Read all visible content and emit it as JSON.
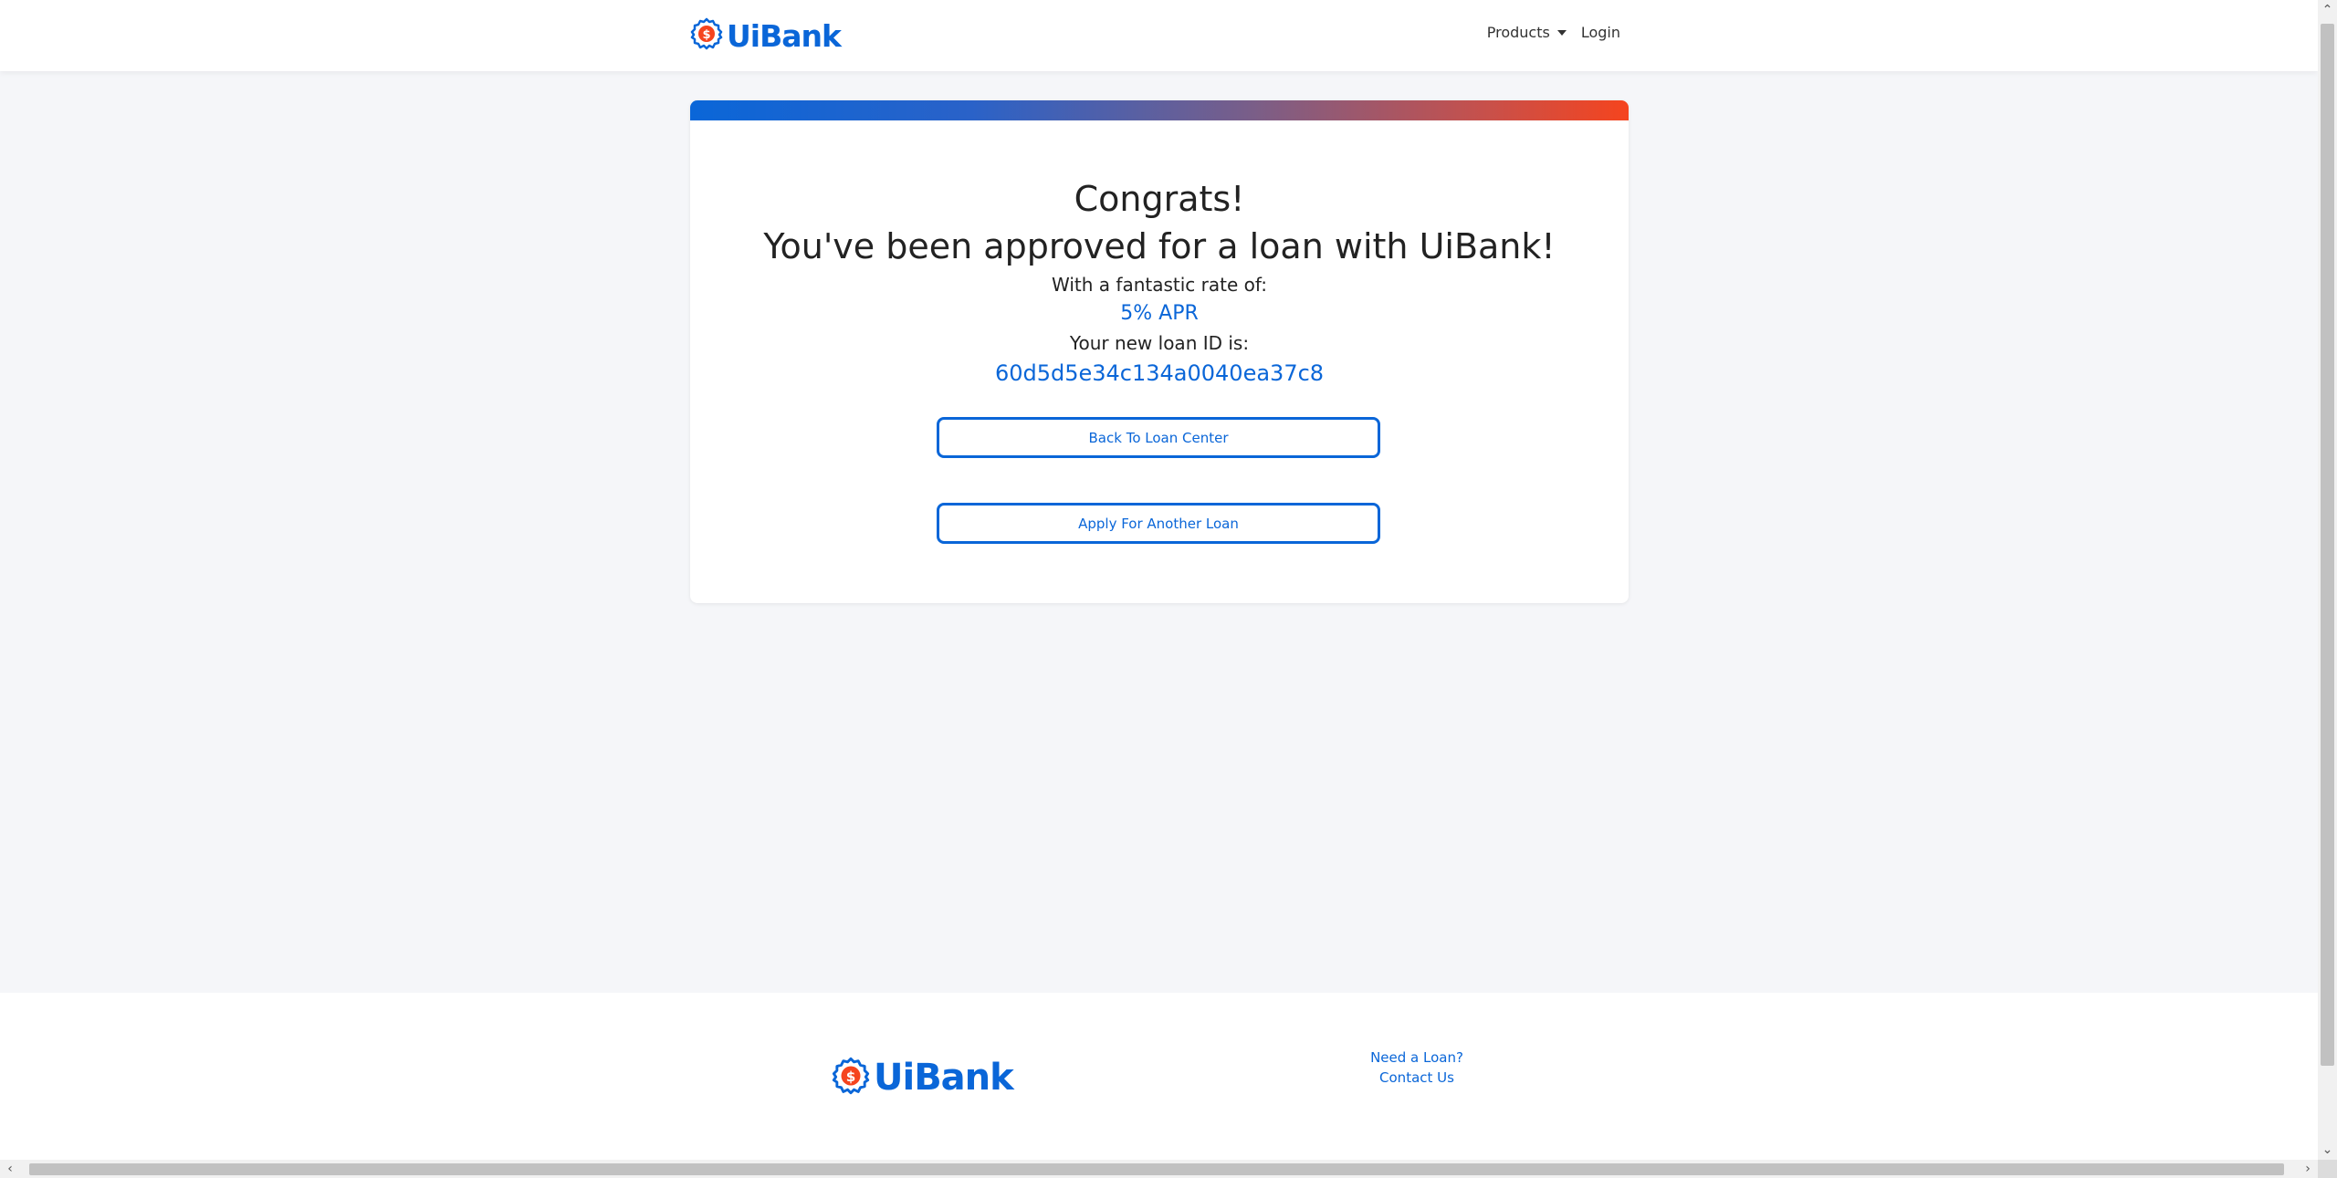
{
  "navbar": {
    "brand_text": "UiBank",
    "products_label": "Products",
    "login_label": "Login"
  },
  "card": {
    "congrats": "Congrats!",
    "approved": "You've been approved for a loan with UiBank!",
    "rate_label": "With a fantastic rate of:",
    "rate_value": "5% APR",
    "loan_label": "Your new loan ID is:",
    "loan_id": "60d5d5e34c134a0040ea37c8",
    "back_button": "Back To Loan Center",
    "apply_button": "Apply For Another Loan"
  },
  "footer": {
    "brand_text": "UiBank",
    "need_loan_link": "Need a Loan?",
    "contact_link": "Contact Us"
  },
  "colors": {
    "brand_blue": "#0a66d8",
    "accent_orange": "#f5441e",
    "background": "#f5f6f9"
  },
  "icons": {
    "logo": "dollar-badge-icon",
    "products_caret": "caret-down-icon"
  }
}
